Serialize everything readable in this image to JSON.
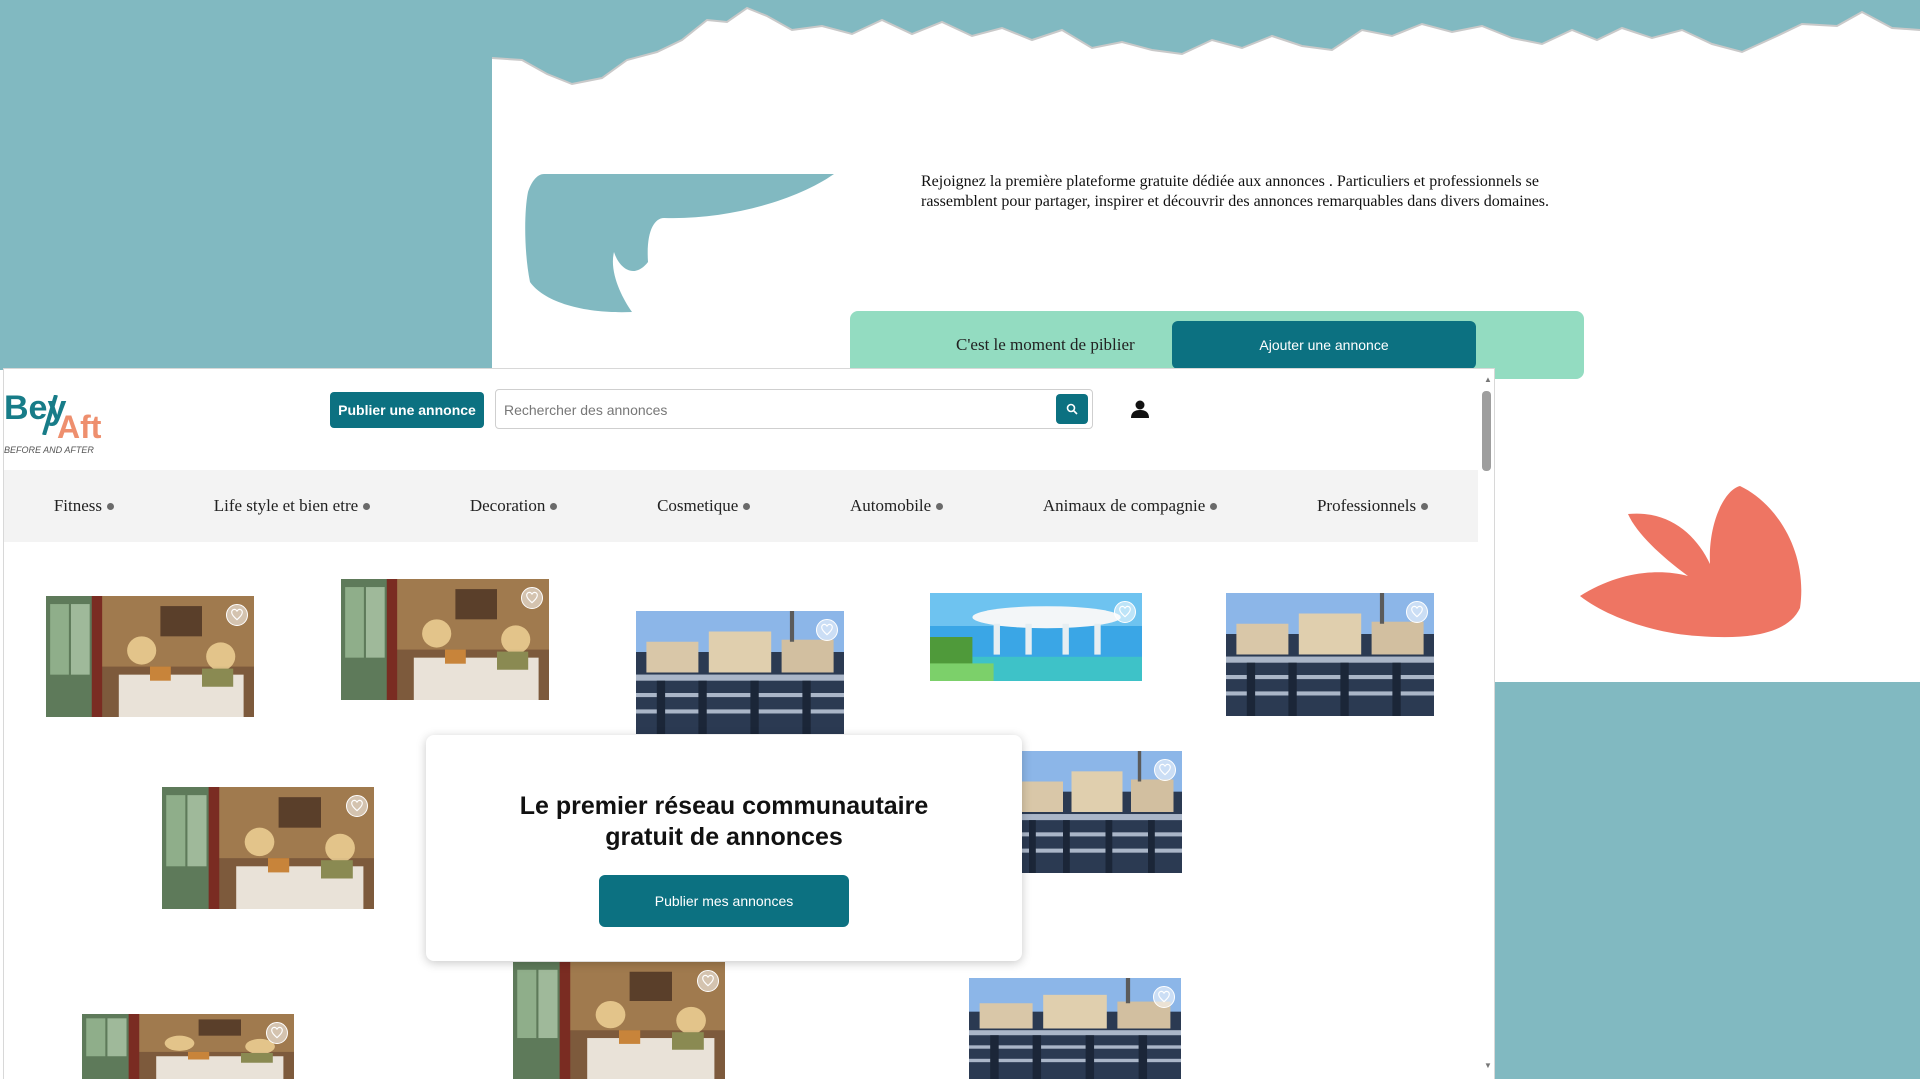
{
  "hero": {
    "intro_text": "Rejoignez la première plateforme gratuite dédiée aux annonces . Particuliers et professionnels se rassemblent pour partager, inspirer et découvrir des annonces remarquables dans divers domaines.",
    "cta_label": "C'est le moment de piblier",
    "cta_button": "Ajouter une annonce"
  },
  "header": {
    "logo_main_1": "Bey",
    "logo_main_2": "Aft",
    "logo_sub": "BEFORE AND AFTER",
    "publish_button": "Publier une annonce",
    "search_placeholder": "Rechercher des annonces",
    "search_icon": "search-icon",
    "user_icon": "user-icon"
  },
  "nav": {
    "items": [
      "Fitness",
      "Life style et bien etre",
      "Decoration",
      "Cosmetique",
      "Automobile",
      "Animaux de compagnie",
      "Professionnels"
    ]
  },
  "cards": [
    {
      "image": "bedroom",
      "icon": "heart-icon"
    },
    {
      "image": "bedroom",
      "icon": "heart-icon"
    },
    {
      "image": "paris-rooftops",
      "icon": "heart-icon"
    },
    {
      "image": "pool-pavilion",
      "icon": "heart-icon"
    },
    {
      "image": "paris-rooftops",
      "icon": "heart-icon"
    },
    {
      "image": "bedroom",
      "icon": "heart-icon"
    },
    {
      "image": "paris-rooftops",
      "icon": "heart-icon"
    },
    {
      "image": "bedroom",
      "icon": "heart-icon"
    },
    {
      "image": "bedroom",
      "icon": "heart-icon"
    },
    {
      "image": "paris-rooftops",
      "icon": "heart-icon"
    }
  ],
  "promo": {
    "title": "Le premier réseau communautaire gratuit de annonces",
    "button": "Publier mes annonces"
  },
  "colors": {
    "teal": "#0c7181",
    "teal_light": "#81b9c1",
    "mint": "#93dcc1",
    "coral": "#ee7563"
  }
}
